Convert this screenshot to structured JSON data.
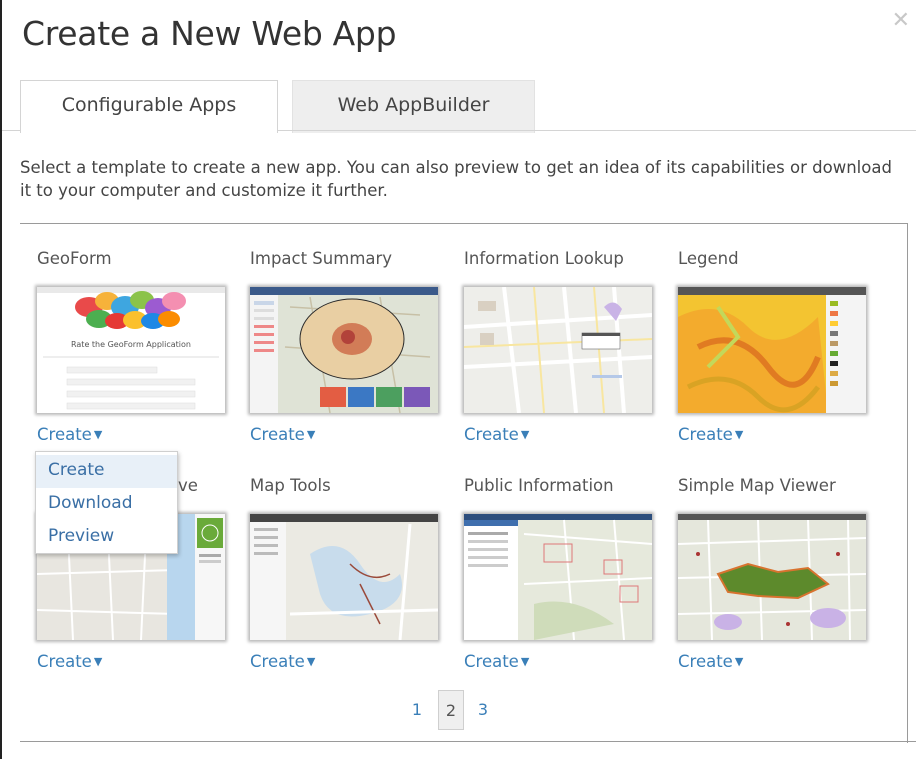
{
  "dialog": {
    "title": "Create a New Web App",
    "close_icon": "close-icon"
  },
  "tabs": [
    {
      "label": "Configurable Apps",
      "active": true
    },
    {
      "label": "Web AppBuilder",
      "active": false
    }
  ],
  "intro_text": "Select a template to create a new app. You can also preview to get an idea of its capabilities or download it to your computer and customize it further.",
  "templates": [
    {
      "title": "GeoForm",
      "action": "Create",
      "thumb_caption": "Rate the GeoForm Application"
    },
    {
      "title": "Impact Summary",
      "action": "Create"
    },
    {
      "title": "Information Lookup",
      "action": "Create"
    },
    {
      "title": "Legend",
      "action": "Create"
    },
    {
      "title": "ve",
      "action": "Create"
    },
    {
      "title": "Map Tools",
      "action": "Create"
    },
    {
      "title": "Public Information",
      "action": "Create"
    },
    {
      "title": "Simple Map Viewer",
      "action": "Create"
    }
  ],
  "dropdown": {
    "items": [
      "Create",
      "Download",
      "Preview"
    ],
    "highlighted": "Create"
  },
  "pagination": {
    "pages": [
      "1",
      "2",
      "3"
    ],
    "current": "2"
  },
  "colors": {
    "link": "#3a7fb8",
    "tab_inactive_bg": "#eeeeee",
    "panel_border": "#9a9a9a"
  }
}
